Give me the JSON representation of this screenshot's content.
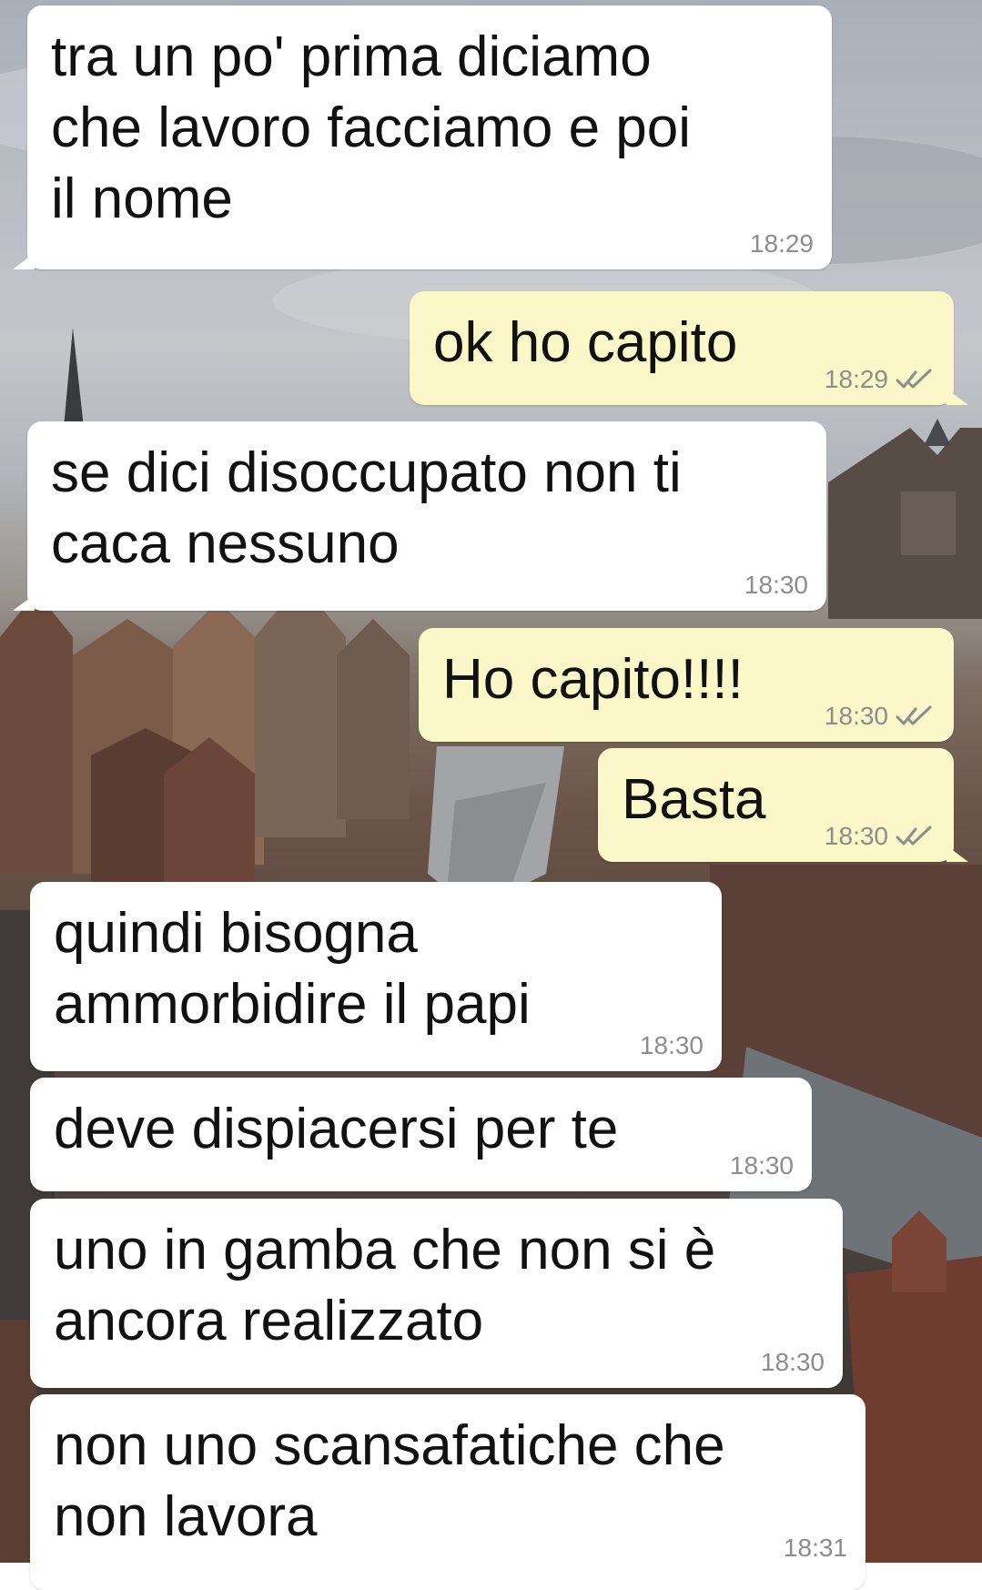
{
  "chat": {
    "messages": [
      {
        "direction": "incoming",
        "text": "tra un po' prima diciamo\nche lavoro facciamo e poi\nil nome",
        "time": "18:29"
      },
      {
        "direction": "outgoing",
        "text": "ok ho capito",
        "time": "18:29",
        "status_icon": "double-check-icon"
      },
      {
        "direction": "incoming",
        "text": "se dici disoccupato non ti\ncaca nessuno",
        "time": "18:30"
      },
      {
        "direction": "outgoing",
        "text": "Ho capito!!!!",
        "time": "18:30",
        "status_icon": "double-check-icon"
      },
      {
        "direction": "outgoing",
        "text": "Basta",
        "time": "18:30",
        "status_icon": "double-check-icon"
      },
      {
        "direction": "incoming",
        "text": "quindi bisogna\nammorbidire il papi",
        "time": "18:30"
      },
      {
        "direction": "incoming",
        "text": "deve dispiacersi per te",
        "time": "18:30"
      },
      {
        "direction": "incoming",
        "text": "uno in gamba che non si è\nancora realizzato",
        "time": "18:30"
      },
      {
        "direction": "incoming",
        "text": "non uno scansafatiche che\nnon lavora",
        "time": "18:31"
      }
    ]
  },
  "colors": {
    "incoming_bubble": "#ffffff",
    "outgoing_bubble": "#fcf7c9",
    "timestamp": "#8d8d8d"
  }
}
